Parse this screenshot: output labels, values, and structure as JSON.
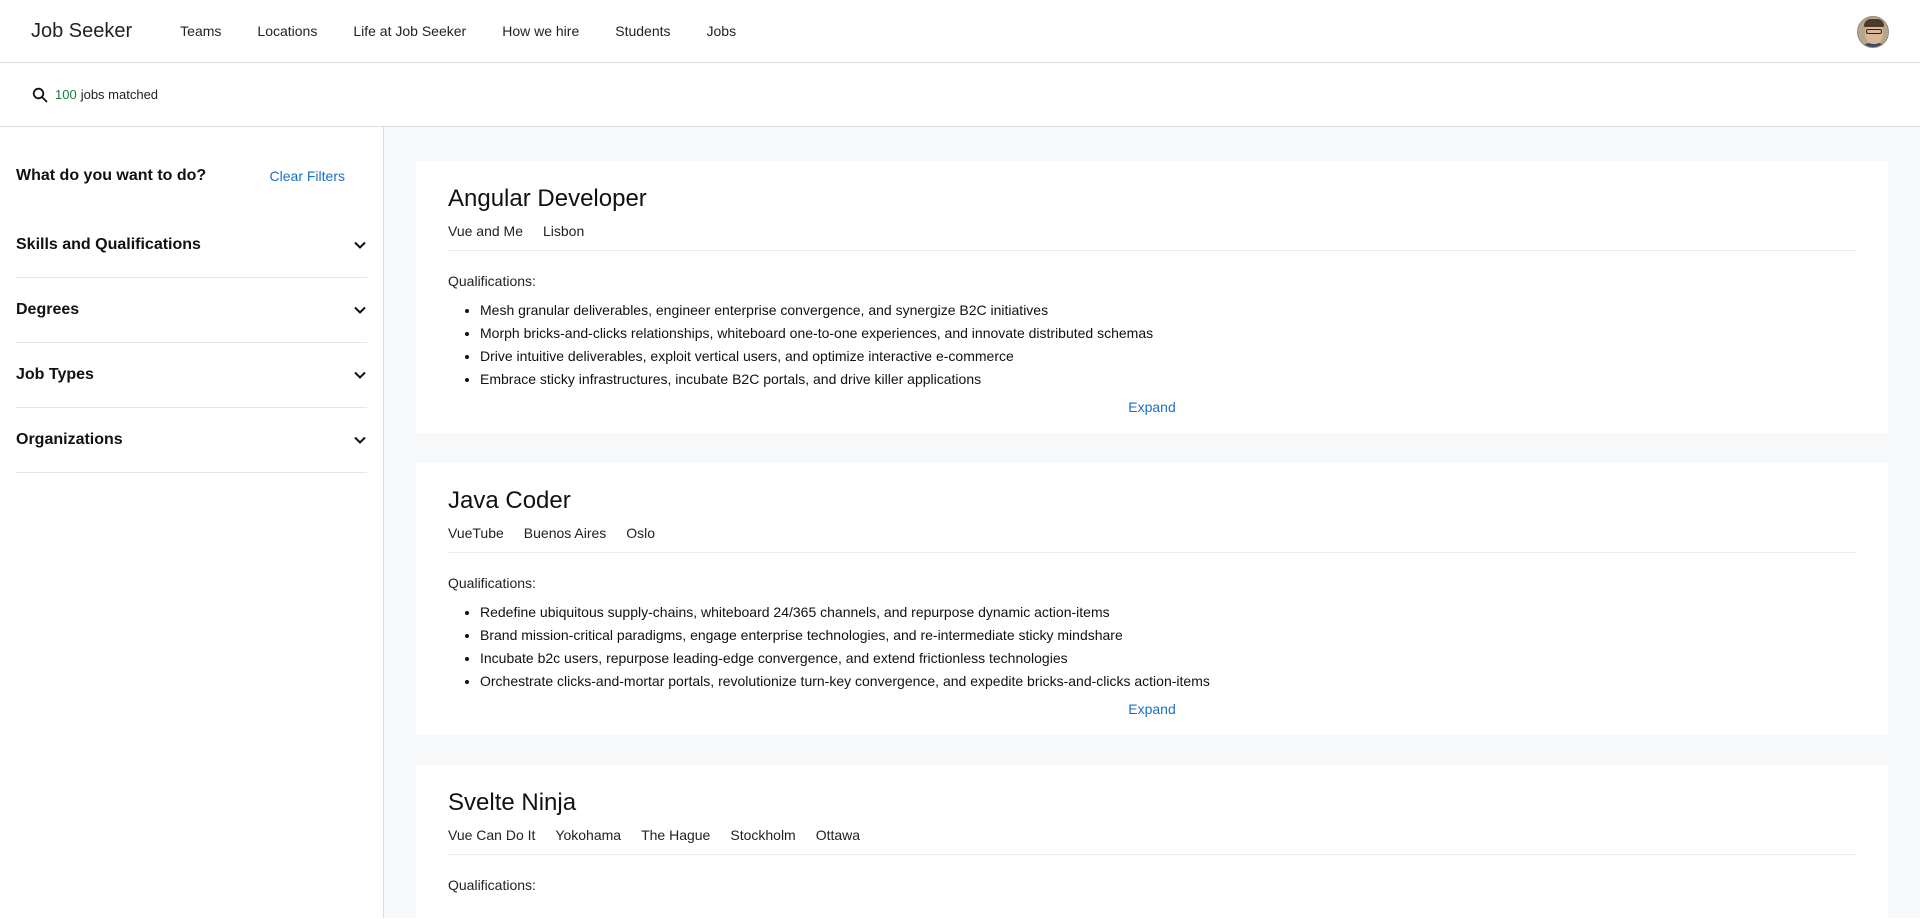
{
  "header": {
    "brand": "Job Seeker",
    "nav": [
      "Teams",
      "Locations",
      "Life at Job Seeker",
      "How we hire",
      "Students",
      "Jobs"
    ]
  },
  "search": {
    "count": "100",
    "suffix": "jobs matched"
  },
  "sidebar": {
    "title": "What do you want to do?",
    "clear_label": "Clear Filters",
    "filters": [
      "Skills and Qualifications",
      "Degrees",
      "Job Types",
      "Organizations"
    ]
  },
  "jobs": [
    {
      "title": "Angular Developer",
      "meta": [
        "Vue and Me",
        "Lisbon"
      ],
      "qualifications_label": "Qualifications:",
      "qualifications": [
        "Mesh granular deliverables, engineer enterprise convergence, and synergize B2C initiatives",
        "Morph bricks-and-clicks relationships, whiteboard one-to-one experiences, and innovate distributed schemas",
        "Drive intuitive deliverables, exploit vertical users, and optimize interactive e-commerce",
        "Embrace sticky infrastructures, incubate B2C portals, and drive killer applications"
      ],
      "expand_label": "Expand"
    },
    {
      "title": "Java Coder",
      "meta": [
        "VueTube",
        "Buenos Aires",
        "Oslo"
      ],
      "qualifications_label": "Qualifications:",
      "qualifications": [
        "Redefine ubiquitous supply-chains, whiteboard 24/365 channels, and repurpose dynamic action-items",
        "Brand mission-critical paradigms, engage enterprise technologies, and re-intermediate sticky mindshare",
        "Incubate b2c users, repurpose leading-edge convergence, and extend frictionless technologies",
        "Orchestrate clicks-and-mortar portals, revolutionize turn-key convergence, and expedite bricks-and-clicks action-items"
      ],
      "expand_label": "Expand"
    },
    {
      "title": "Svelte Ninja",
      "meta": [
        "Vue Can Do It",
        "Yokohama",
        "The Hague",
        "Stockholm",
        "Ottawa"
      ],
      "qualifications_label": "Qualifications:",
      "qualifications": [],
      "expand_label": ""
    }
  ],
  "colors": {
    "accent": "#1a6fc9",
    "count": "#1a7f37",
    "main_bg": "#f7f8fa"
  }
}
